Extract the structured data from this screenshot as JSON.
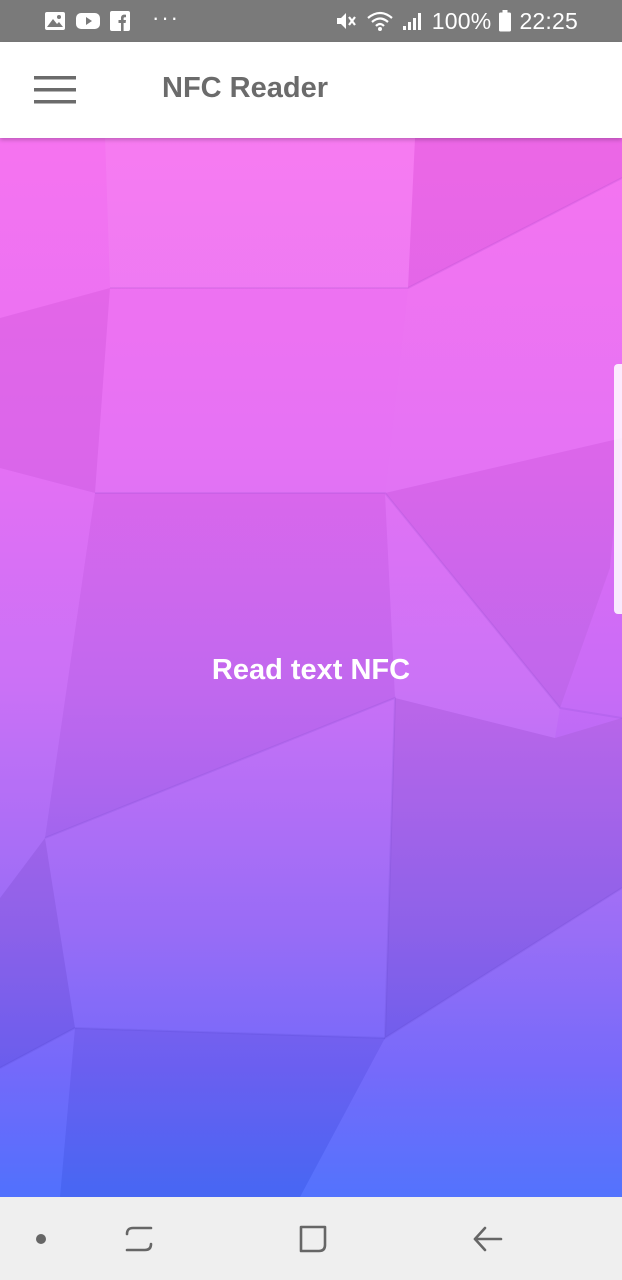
{
  "status_bar": {
    "battery": "100%",
    "time": "22:25",
    "notification_icons": [
      "gallery-icon",
      "youtube-icon",
      "facebook-icon"
    ],
    "more": "···"
  },
  "app_bar": {
    "title": "NFC Reader"
  },
  "main": {
    "action_label": "Read text NFC",
    "gradient_top": "#f66cf0",
    "gradient_bottom": "#4a6cfd"
  },
  "nav_bar": {
    "buttons": [
      "dot-icon",
      "recents-icon",
      "home-icon",
      "back-icon"
    ]
  }
}
